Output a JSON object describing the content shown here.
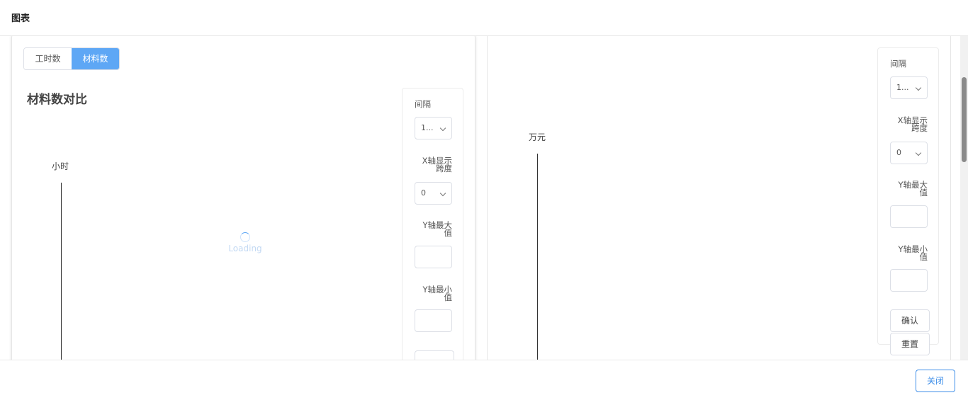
{
  "dialog": {
    "title": "图表",
    "close_label": "关闭"
  },
  "left_card": {
    "tabs": [
      {
        "label": "工时数",
        "active": false
      },
      {
        "label": "材料数",
        "active": true
      }
    ],
    "chart_title": "材料数对比",
    "unit_label": "小时",
    "loading_text": "Loading",
    "controls": {
      "interval_label": "间隔",
      "interval_value": "1...",
      "x_span_label_1": "X轴显示",
      "x_span_label_2": "跨度",
      "x_span_value": "0",
      "y_max_label_1": "Y轴最大",
      "y_max_label_2": "值",
      "y_min_label_1": "Y轴最小",
      "y_min_label_2": "值",
      "y_max_value": "",
      "y_min_value": ""
    }
  },
  "right_card": {
    "unit_label": "万元",
    "controls": {
      "interval_label": "间隔",
      "interval_value": "1...",
      "x_span_label_1": "X轴显示",
      "x_span_label_2": "跨度",
      "x_span_value": "0",
      "y_max_label_1": "Y轴最大",
      "y_max_label_2": "值",
      "y_min_label_1": "Y轴最小",
      "y_min_label_2": "值",
      "y_max_value": "",
      "y_min_value": "",
      "confirm_label": "确认",
      "reset_label": "重置"
    }
  },
  "colors": {
    "accent": "#5ea7f5",
    "close_border": "#3d8ee8",
    "loading_text": "#c3d9f3"
  }
}
